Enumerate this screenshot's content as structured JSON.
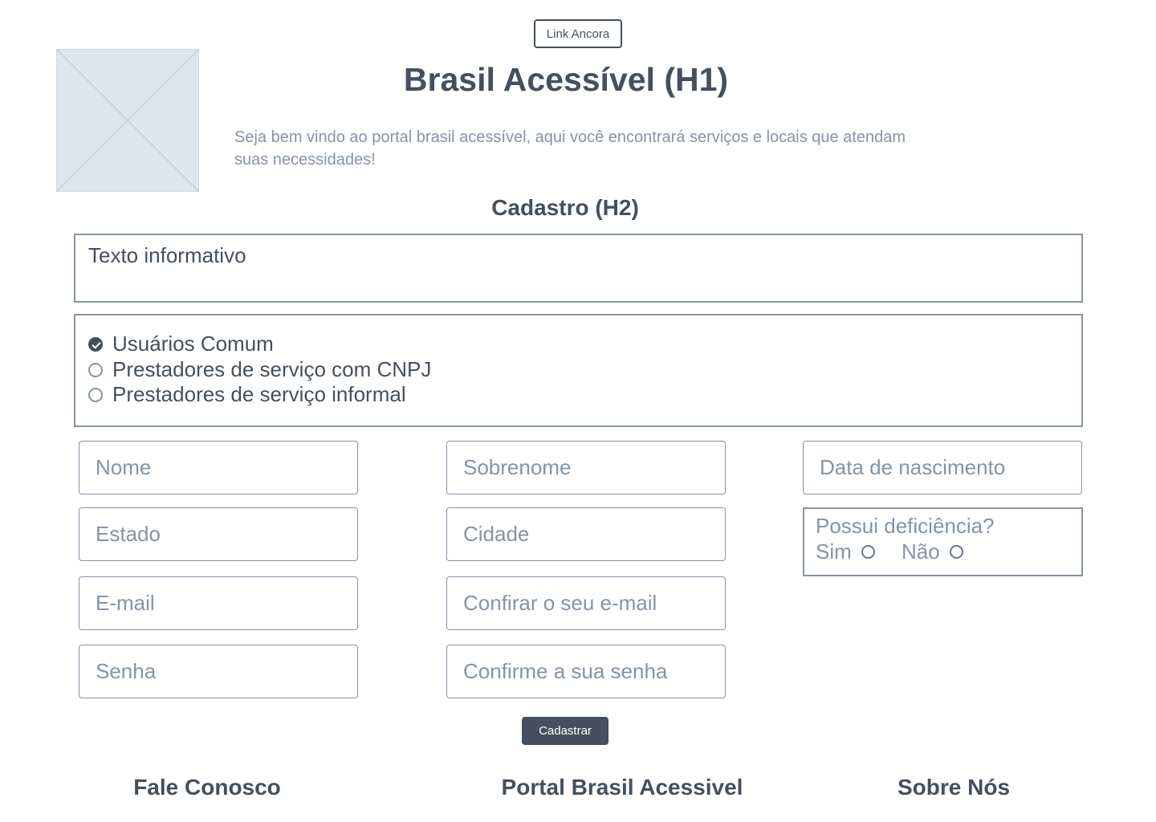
{
  "header": {
    "anchor_link_label": "Link Ancora",
    "title": "Brasil Acessível (H1)",
    "intro": "Seja bem vindo ao portal brasil acessível, aqui você encontrará serviços e locais que atendam suas necessidades!"
  },
  "form": {
    "title": "Cadastro (H2)",
    "info_text": "Texto informativo",
    "user_types": [
      {
        "label": "Usuários Comum",
        "checked": true
      },
      {
        "label": "Prestadores de serviço com CNPJ",
        "checked": false
      },
      {
        "label": "Prestadores de serviço informal",
        "checked": false
      }
    ],
    "placeholders": {
      "first_name": "Nome",
      "last_name": "Sobrenome",
      "birth_date": "Data de nascimento",
      "state": "Estado",
      "city": "Cidade",
      "email": "E-mail",
      "email_confirm": "Confirar o seu e-mail",
      "password": "Senha",
      "password_confirm": "Confirme a sua senha"
    },
    "disability": {
      "question": "Possui deficiência?",
      "yes_label": "Sim",
      "no_label": "Não"
    },
    "submit_label": "Cadastrar"
  },
  "footer": {
    "contact": "Fale Conosco",
    "portal": "Portal Brasil Acessivel",
    "about": "Sobre Nós"
  },
  "colors": {
    "primary": "#454f5d",
    "muted": "#8593a8",
    "placeholder_image_bg": "#dfe5ee"
  }
}
